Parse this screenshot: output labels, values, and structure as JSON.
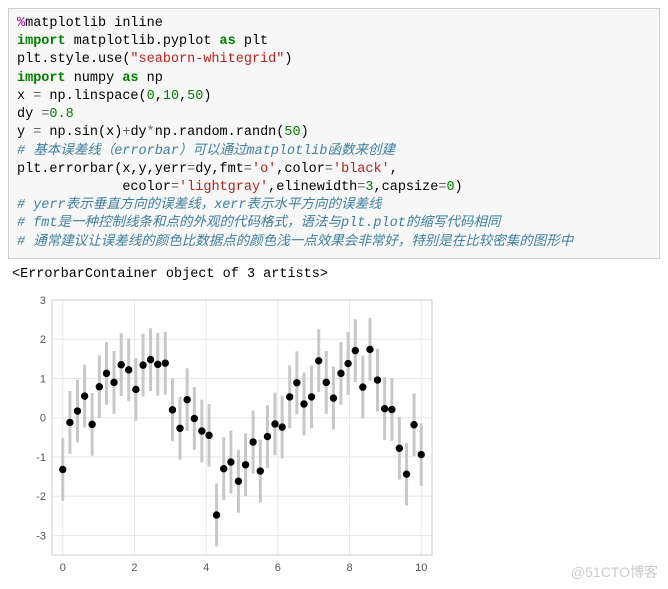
{
  "code": {
    "l1_magic": "%",
    "l1_rest": "matplotlib inline",
    "l2_import": "import",
    "l2_rest": " matplotlib.pyplot ",
    "l2_as": "as",
    "l2_alias": " plt",
    "l3_a": "plt.style.use(",
    "l3_str": "\"seaborn-whitegrid\"",
    "l3_b": ")",
    "l4_import": "import",
    "l4_rest": " numpy ",
    "l4_as": "as",
    "l4_alias": " np",
    "l5_a": "x ",
    "l5_eq": "=",
    "l5_b": " np.linspace(",
    "l5_n1": "0",
    "l5_c": ",",
    "l5_n2": "10",
    "l5_d": ",",
    "l5_n3": "50",
    "l5_e": ")",
    "l6_a": "dy ",
    "l6_eq": "=",
    "l6_n": "0.8",
    "l7_a": "y ",
    "l7_eq": "=",
    "l7_b": " np.sin(x)",
    "l7_plus": "+",
    "l7_c": "dy",
    "l7_mul": "*",
    "l7_d": "np.random.randn(",
    "l7_n": "50",
    "l7_e": ")",
    "c1": "# 基本误差线（errorbar）可以通过matplotlib函数来创建",
    "l8_a": "plt.errorbar(x,y,yerr",
    "l8_eq1": "=",
    "l8_b": "dy,fmt",
    "l8_eq2": "=",
    "l8_s1": "'o'",
    "l8_c": ",color",
    "l8_eq3": "=",
    "l8_s2": "'black'",
    "l8_d": ",",
    "l9_pad": "             ecolor",
    "l9_eq1": "=",
    "l9_s1": "'lightgray'",
    "l9_a": ",elinewidth",
    "l9_eq2": "=",
    "l9_n1": "3",
    "l9_b": ",capsize",
    "l9_eq3": "=",
    "l9_n2": "0",
    "l9_c": ")",
    "c2": "# yerr表示垂直方向的误差线，xerr表示水平方向的误差线",
    "c3": "# fmt是一种控制线条和点的外观的代码格式，语法与plt.plot的缩写代码相同",
    "c4": "# 通常建议让误差线的颜色比数据点的颜色浅一点效果会非常好，特别是在比较密集的图形中"
  },
  "output_text": "<ErrorbarContainer object of 3 artists>",
  "watermark": "@51CTO博客",
  "chart_data": {
    "type": "errorbar-scatter",
    "title": "",
    "xlabel": "",
    "ylabel": "",
    "xlim": [
      -0.3,
      10.3
    ],
    "ylim": [
      -3.5,
      3.0
    ],
    "xticks": [
      0,
      2,
      4,
      6,
      8,
      10
    ],
    "yticks": [
      -3,
      -2,
      -1,
      0,
      1,
      2,
      3
    ],
    "yerr": 0.8,
    "x": [
      0.0,
      0.2,
      0.41,
      0.61,
      0.82,
      1.02,
      1.22,
      1.43,
      1.63,
      1.84,
      2.04,
      2.24,
      2.45,
      2.65,
      2.86,
      3.06,
      3.27,
      3.47,
      3.67,
      3.88,
      4.08,
      4.29,
      4.49,
      4.69,
      4.9,
      5.1,
      5.31,
      5.51,
      5.71,
      5.92,
      6.12,
      6.33,
      6.53,
      6.73,
      6.94,
      7.14,
      7.35,
      7.55,
      7.76,
      7.96,
      8.16,
      8.37,
      8.57,
      8.78,
      8.98,
      9.18,
      9.39,
      9.59,
      9.8,
      10.0
    ],
    "y": [
      -1.32,
      -0.12,
      0.17,
      0.55,
      -0.17,
      0.79,
      1.13,
      0.9,
      1.35,
      1.22,
      0.72,
      1.34,
      1.48,
      1.36,
      1.39,
      0.2,
      -0.27,
      0.46,
      -0.02,
      -0.34,
      -0.45,
      -2.48,
      -1.3,
      -1.13,
      -1.62,
      -1.2,
      -0.62,
      -1.36,
      -0.48,
      -0.16,
      -0.24,
      0.53,
      0.89,
      0.35,
      0.53,
      1.45,
      0.9,
      0.5,
      1.13,
      1.38,
      1.71,
      0.78,
      1.74,
      0.96,
      0.23,
      0.21,
      -0.78,
      -1.44,
      -0.18,
      -0.94
    ]
  }
}
